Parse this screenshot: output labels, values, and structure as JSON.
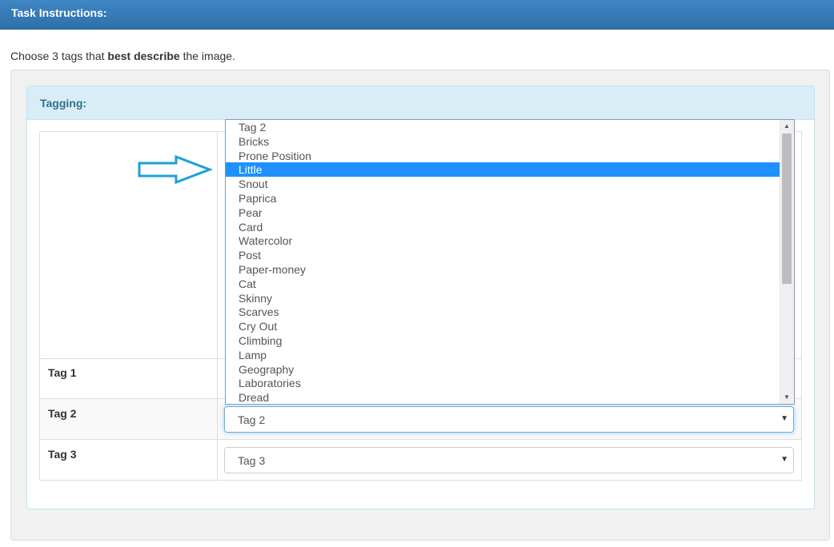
{
  "header": {
    "title": "Task Instructions:"
  },
  "instruction": {
    "prefix": "Choose 3 tags that ",
    "bold": "best describe",
    "suffix": " the image."
  },
  "panel": {
    "title": "Tagging:"
  },
  "rows": [
    {
      "label": "Tag 1",
      "value": ""
    },
    {
      "label": "Tag 2",
      "value": "Tag 2"
    },
    {
      "label": "Tag 3",
      "value": "Tag 3"
    }
  ],
  "dropdown": {
    "selected_index": 3,
    "options": [
      "Tag 2",
      "Bricks",
      "Prone Position",
      "Little",
      "Snout",
      "Paprica",
      "Pear",
      "Card",
      "Watercolor",
      "Post",
      "Paper-money",
      "Cat",
      "Skinny",
      "Scarves",
      "Cry Out",
      "Climbing",
      "Lamp",
      "Geography",
      "Laboratories",
      "Dread"
    ]
  },
  "icons": {
    "caret": "caret-down-icon",
    "arrow": "arrow-right-icon"
  },
  "colors": {
    "header": "#3f86c5",
    "panel_heading": "#d9edf7",
    "selected": "#1e90ff",
    "arrow": "#1ca0d6"
  }
}
